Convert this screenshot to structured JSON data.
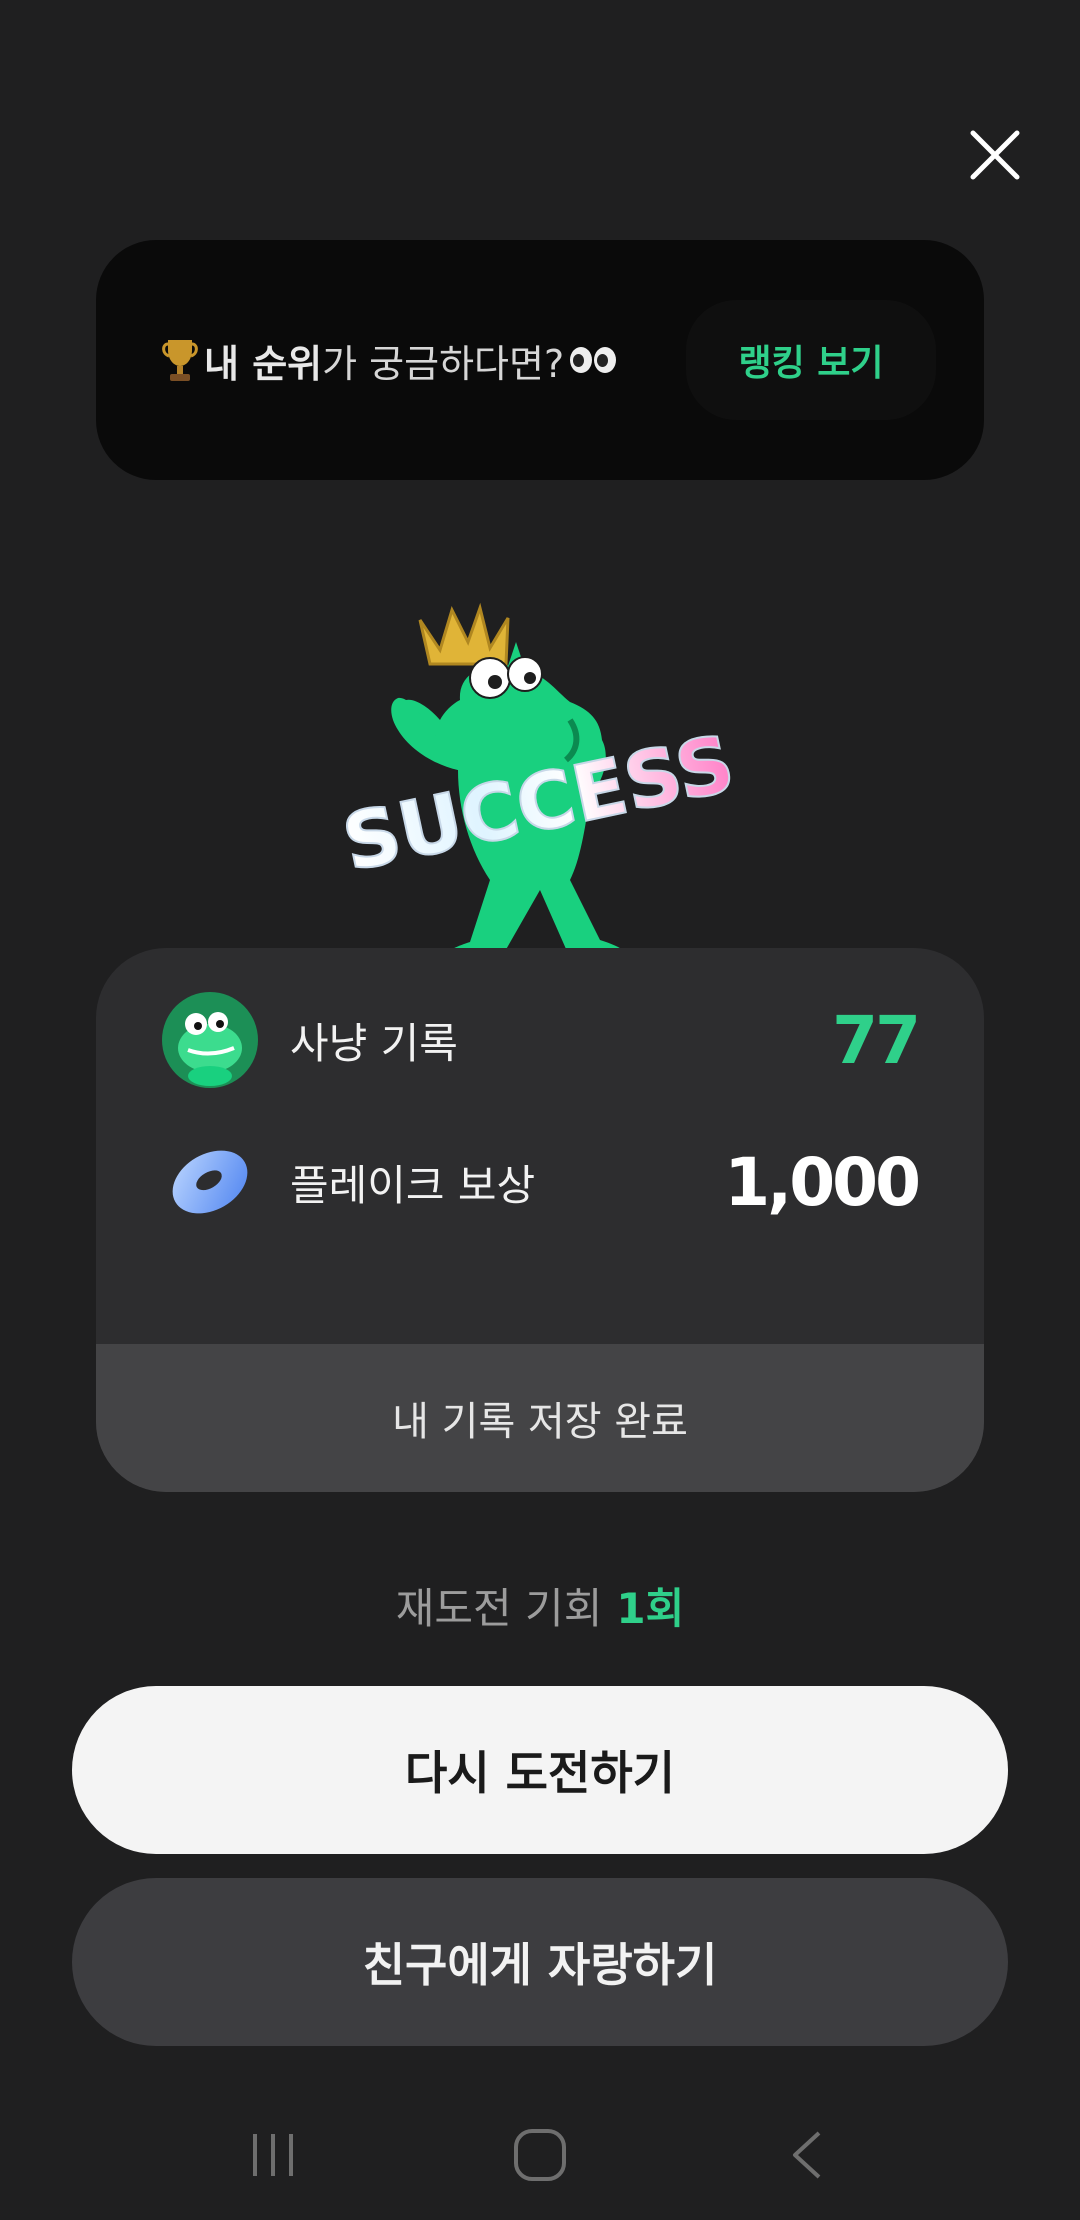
{
  "rank_banner": {
    "text_bold": "내 순위",
    "text_rest": "가 궁금하다면?",
    "button_label": "랭킹 보기"
  },
  "result": {
    "record_label": "사냥 기록",
    "record_value": "77",
    "reward_label": "플레이크 보상",
    "reward_value": "1,000",
    "saved_text": "내 기록 저장 완료"
  },
  "retry": {
    "label": "재도전 기회",
    "count": "1회"
  },
  "buttons": {
    "retry_label": "다시 도전하기",
    "share_label": "친구에게 자랑하기"
  },
  "mascot": {
    "badge_text": "SUCCESS"
  },
  "colors": {
    "accent": "#2fd08a",
    "background": "#1f1f20",
    "card": "#2d2d2f"
  }
}
